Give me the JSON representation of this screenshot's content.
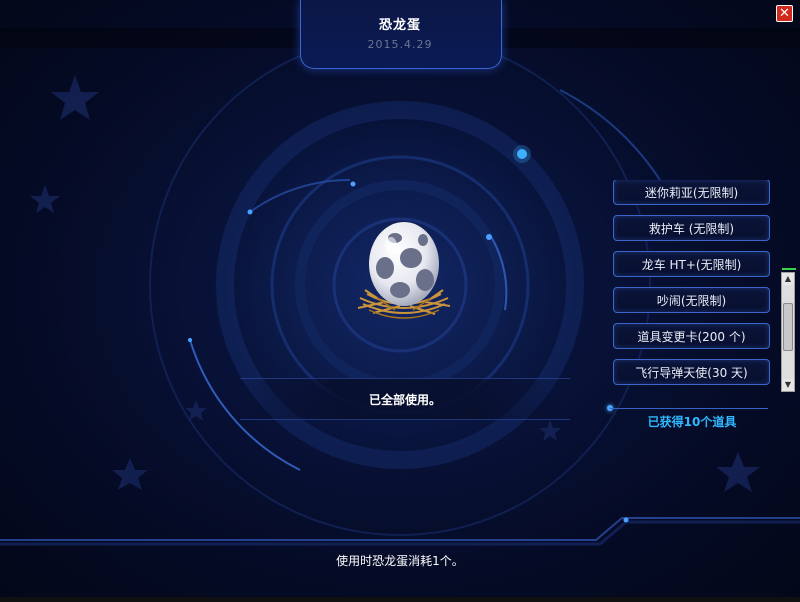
{
  "window": {
    "title": "恐龙蛋",
    "date": "2015.4.29",
    "close_label": "✕"
  },
  "item": {
    "icon": "dinosaur-egg-icon",
    "status": "已全部使用。"
  },
  "rewards": {
    "items": [
      {
        "label": "迷你莉亚(无限制)"
      },
      {
        "label": "救护车 (无限制)"
      },
      {
        "label": "龙车 HT+(无限制)"
      },
      {
        "label": "吵闹(无限制)"
      },
      {
        "label": "道具变更卡(200 个)"
      },
      {
        "label": "飞行导弹天使(30 天)"
      }
    ],
    "acquired_text": "已获得10个道具"
  },
  "footer": {
    "usage_text": "使用时恐龙蛋消耗1个。"
  },
  "colors": {
    "accent": "#3867c9",
    "highlight": "#2fb8ff",
    "close": "#d12a1c"
  }
}
